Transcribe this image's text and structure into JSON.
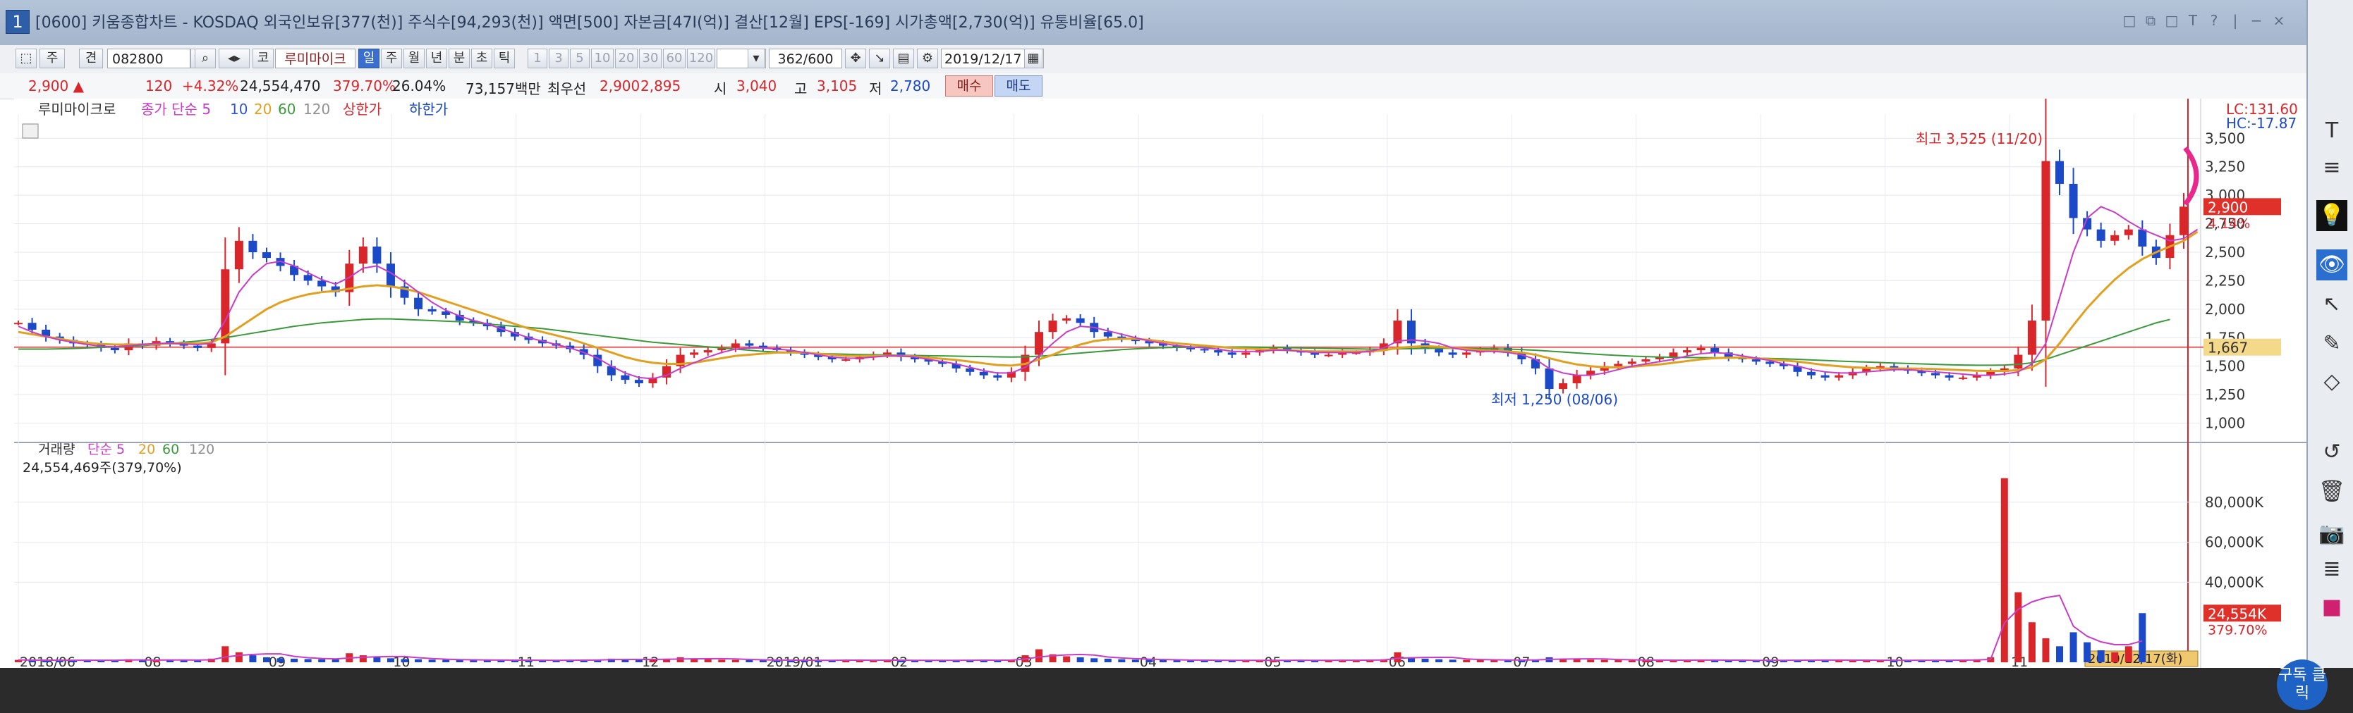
{
  "window": {
    "title": "[0600] 키움종합차트 - KOSDAQ 외국인보유[377(천)] 주식수[94,293(천)] 액면[500] 자본금[47I(억)] 결산[12월] EPS[-169] 시가총액[2,730(억)] 유통비율[65.0]",
    "app_icon": "1",
    "controls": [
      "□",
      "⧉",
      "□",
      "T",
      "?",
      "|",
      "−",
      "×"
    ]
  },
  "toolbar": {
    "main_menu": "주",
    "period_type": "견",
    "stock_code": "082800",
    "stock_prefix": "코",
    "stock_name": "루미마이크",
    "periods": [
      "일",
      "주",
      "월",
      "년",
      "분",
      "초",
      "틱"
    ],
    "minutes": [
      "1",
      "3",
      "5",
      "10",
      "20",
      "30",
      "60",
      "120"
    ],
    "count": "362/600",
    "date": "2019/12/17"
  },
  "quote": {
    "price": "2,900 ▲",
    "change": "120",
    "change_pct": "+4.32%",
    "volume": "24,554,470",
    "volume_ratio": "379.70%",
    "turnover": "26.04%",
    "amount": "73,157백만",
    "best_ask_label": "최우선",
    "ask": "2,900",
    "bid": "2,895",
    "open_label": "시",
    "open": "3,040",
    "high_label": "고",
    "high": "3,105",
    "low_label": "저",
    "low": "2,780",
    "buy_label": "매수",
    "sell_label": "매도"
  },
  "colors": {
    "up": "#d8262b",
    "down": "#1b49c8",
    "ma5": "#c83cc8",
    "ma10": "#3355cc",
    "ma20": "#e0a020",
    "ma60": "#3a9a3a",
    "ma120": "#909090"
  },
  "chart_data": [
    {
      "type": "candlestick",
      "title": "",
      "legend": {
        "name": "루미마이크로",
        "items": [
          "종가 단순 5",
          "10",
          "20",
          "60",
          "120",
          "상한가",
          "하한가"
        ]
      },
      "x_ticks": [
        "2018/06",
        "08",
        "09",
        "10",
        "11",
        "12",
        "2019/01",
        "02",
        "03",
        "04",
        "05",
        "06",
        "07",
        "08",
        "09",
        "10",
        "11",
        "12"
      ],
      "y_ticks": [
        "3,500",
        "3,250",
        "3,000",
        "2,750",
        "2,500",
        "2,250",
        "2,000",
        "1,750",
        "1,500",
        "1,250",
        "1,000"
      ],
      "ylim": [
        880,
        3650
      ],
      "annotations": {
        "high": "최고 3,525 (11/20)",
        "low": "최저 1,250 (08/06)",
        "lc": "LC:131.60",
        "hc": "HC:-17.87",
        "price_tag": "2,900",
        "pct_tag": "4.14%",
        "ref_tag": "1,667"
      },
      "reference_line": 1667,
      "series_close": [
        1880,
        1820,
        1760,
        1730,
        1700,
        1690,
        1660,
        1640,
        1700,
        1680,
        1720,
        1700,
        1680,
        1660,
        1700,
        2350,
        2600,
        2500,
        2450,
        2380,
        2300,
        2250,
        2200,
        2150,
        2400,
        2550,
        2400,
        2200,
        2100,
        2000,
        1980,
        1950,
        1900,
        1880,
        1850,
        1800,
        1760,
        1730,
        1700,
        1680,
        1650,
        1600,
        1500,
        1420,
        1380,
        1350,
        1400,
        1500,
        1600,
        1620,
        1640,
        1660,
        1700,
        1680,
        1660,
        1640,
        1620,
        1600,
        1580,
        1560,
        1560,
        1580,
        1600,
        1620,
        1580,
        1560,
        1540,
        1520,
        1480,
        1450,
        1420,
        1400,
        1450,
        1600,
        1800,
        1900,
        1920,
        1880,
        1800,
        1760,
        1740,
        1720,
        1700,
        1680,
        1660,
        1650,
        1640,
        1620,
        1600,
        1620,
        1640,
        1660,
        1640,
        1620,
        1600,
        1600,
        1620,
        1620,
        1640,
        1700,
        1900,
        1700,
        1650,
        1620,
        1600,
        1620,
        1640,
        1660,
        1620,
        1560,
        1480,
        1300,
        1350,
        1420,
        1460,
        1500,
        1520,
        1540,
        1560,
        1580,
        1620,
        1640,
        1660,
        1620,
        1580,
        1560,
        1540,
        1520,
        1500,
        1450,
        1420,
        1400,
        1420,
        1450,
        1480,
        1500,
        1480,
        1460,
        1440,
        1420,
        1400,
        1400,
        1420,
        1450,
        1480,
        1600,
        1900,
        3300,
        3100,
        2800,
        2700,
        2600,
        2650,
        2700,
        2550,
        2450,
        2650,
        2900
      ],
      "ma5": [
        1850,
        1800,
        1760,
        1730,
        1710,
        1690,
        1675,
        1670,
        1680,
        1690,
        1700,
        1700,
        1695,
        1690,
        1700,
        1900,
        2150,
        2300,
        2400,
        2420,
        2380,
        2320,
        2260,
        2220,
        2280,
        2360,
        2380,
        2320,
        2240,
        2150,
        2060,
        1990,
        1940,
        1900,
        1870,
        1830,
        1790,
        1750,
        1720,
        1690,
        1660,
        1620,
        1570,
        1500,
        1440,
        1400,
        1390,
        1420,
        1480,
        1530,
        1580,
        1620,
        1650,
        1660,
        1660,
        1650,
        1640,
        1620,
        1600,
        1580,
        1570,
        1570,
        1580,
        1590,
        1590,
        1580,
        1560,
        1540,
        1520,
        1490,
        1460,
        1440,
        1440,
        1490,
        1590,
        1700,
        1800,
        1850,
        1840,
        1810,
        1780,
        1750,
        1720,
        1700,
        1680,
        1670,
        1660,
        1650,
        1630,
        1630,
        1630,
        1640,
        1640,
        1630,
        1620,
        1620,
        1620,
        1620,
        1630,
        1660,
        1720,
        1730,
        1720,
        1700,
        1660,
        1640,
        1630,
        1630,
        1620,
        1600,
        1560,
        1480,
        1440,
        1420,
        1420,
        1440,
        1470,
        1500,
        1520,
        1540,
        1560,
        1590,
        1610,
        1620,
        1610,
        1590,
        1570,
        1550,
        1520,
        1500,
        1470,
        1450,
        1440,
        1440,
        1450,
        1460,
        1470,
        1470,
        1460,
        1450,
        1440,
        1430,
        1420,
        1420,
        1430,
        1450,
        1520,
        1700,
        2100,
        2500,
        2800,
        2900,
        2850,
        2770,
        2700,
        2650,
        2600,
        2620,
        2700
      ],
      "ma20": [
        1800,
        1780,
        1760,
        1740,
        1720,
        1705,
        1695,
        1690,
        1690,
        1690,
        1695,
        1700,
        1700,
        1700,
        1710,
        1760,
        1840,
        1920,
        2000,
        2060,
        2100,
        2130,
        2150,
        2160,
        2180,
        2200,
        2210,
        2200,
        2180,
        2150,
        2110,
        2070,
        2030,
        1990,
        1950,
        1910,
        1870,
        1830,
        1800,
        1770,
        1740,
        1700,
        1660,
        1620,
        1580,
        1550,
        1530,
        1520,
        1520,
        1530,
        1550,
        1570,
        1590,
        1600,
        1610,
        1620,
        1620,
        1620,
        1610,
        1600,
        1590,
        1590,
        1590,
        1590,
        1590,
        1585,
        1575,
        1565,
        1555,
        1540,
        1525,
        1510,
        1505,
        1520,
        1560,
        1600,
        1650,
        1690,
        1720,
        1735,
        1740,
        1740,
        1730,
        1715,
        1700,
        1690,
        1680,
        1670,
        1660,
        1655,
        1650,
        1645,
        1640,
        1635,
        1630,
        1630,
        1630,
        1630,
        1630,
        1640,
        1660,
        1670,
        1675,
        1670,
        1660,
        1650,
        1640,
        1635,
        1630,
        1620,
        1600,
        1570,
        1540,
        1515,
        1500,
        1490,
        1490,
        1495,
        1505,
        1515,
        1530,
        1545,
        1560,
        1570,
        1575,
        1575,
        1570,
        1560,
        1550,
        1540,
        1525,
        1510,
        1500,
        1490,
        1485,
        1480,
        1480,
        1480,
        1478,
        1475,
        1470,
        1465,
        1460,
        1458,
        1458,
        1465,
        1490,
        1560,
        1700,
        1860,
        2010,
        2140,
        2260,
        2360,
        2440,
        2500,
        2550,
        2600,
        2680
      ],
      "ma60": [
        1650,
        1650,
        1650,
        1652,
        1655,
        1660,
        1665,
        1670,
        1675,
        1680,
        1690,
        1700,
        1710,
        1720,
        1735,
        1750,
        1770,
        1790,
        1810,
        1830,
        1850,
        1865,
        1880,
        1890,
        1900,
        1910,
        1915,
        1915,
        1910,
        1905,
        1900,
        1895,
        1890,
        1880,
        1870,
        1860,
        1850,
        1840,
        1830,
        1815,
        1800,
        1785,
        1770,
        1755,
        1740,
        1725,
        1710,
        1700,
        1690,
        1680,
        1670,
        1660,
        1650,
        1640,
        1630,
        1625,
        1620,
        1615,
        1610,
        1608,
        1605,
        1602,
        1600,
        1598,
        1596,
        1594,
        1592,
        1590,
        1588,
        1586,
        1584,
        1582,
        1580,
        1582,
        1588,
        1595,
        1605,
        1615,
        1625,
        1635,
        1645,
        1652,
        1658,
        1662,
        1665,
        1667,
        1668,
        1668,
        1668,
        1668,
        1666,
        1664,
        1662,
        1660,
        1658,
        1656,
        1654,
        1652,
        1650,
        1650,
        1652,
        1654,
        1656,
        1657,
        1657,
        1656,
        1654,
        1652,
        1650,
        1646,
        1640,
        1632,
        1624,
        1616,
        1608,
        1600,
        1594,
        1588,
        1584,
        1580,
        1578,
        1576,
        1575,
        1574,
        1573,
        1572,
        1570,
        1568,
        1565,
        1560,
        1555,
        1550,
        1545,
        1540,
        1536,
        1532,
        1528,
        1524,
        1520,
        1516,
        1512,
        1510,
        1508,
        1508,
        1510,
        1516,
        1530,
        1560,
        1600,
        1640,
        1680,
        1720,
        1760,
        1800,
        1840,
        1880,
        1910
      ]
    },
    {
      "type": "bar",
      "title": "",
      "legend": {
        "name": "거래량",
        "items": [
          "단순 5",
          "20",
          "60",
          "120"
        ],
        "value": "24,554,469주(379,70%)"
      },
      "y_ticks": [
        "80,000K",
        "60,000K",
        "40,000K"
      ],
      "ylim": [
        0,
        100000
      ],
      "last_volume_tag": "24,554K",
      "last_pct_tag": "379.70%",
      "cursor_date": "2019/12/17(화)",
      "values": [
        1200,
        900,
        1100,
        800,
        1000,
        1300,
        900,
        1100,
        1500,
        1200,
        900,
        1000,
        1100,
        1300,
        1800,
        8000,
        5000,
        3500,
        2500,
        2000,
        1800,
        1600,
        1500,
        1400,
        4500,
        3500,
        2800,
        2000,
        1600,
        1500,
        1300,
        1200,
        1100,
        1000,
        1200,
        900,
        1100,
        1000,
        900,
        1000,
        1100,
        1200,
        1400,
        1800,
        1500,
        1200,
        1100,
        1800,
        2500,
        1900,
        1500,
        1300,
        1200,
        1100,
        1000,
        900,
        1000,
        1100,
        900,
        1000,
        1200,
        1000,
        900,
        1100,
        1000,
        900,
        1000,
        900,
        1100,
        1200,
        1000,
        900,
        1400,
        3500,
        6500,
        4000,
        3000,
        2500,
        2000,
        1800,
        1500,
        1300,
        1200,
        1100,
        1000,
        1000,
        900,
        1000,
        900,
        1100,
        1000,
        900,
        1000,
        1000,
        900,
        1000,
        1100,
        1000,
        1200,
        1500,
        5000,
        2500,
        1800,
        1500,
        1300,
        1200,
        1100,
        1100,
        1000,
        1200,
        1400,
        2500,
        1800,
        1500,
        1300,
        1200,
        1100,
        1000,
        1000,
        1100,
        1000,
        1200,
        1100,
        1000,
        900,
        1000,
        900,
        1000,
        1100,
        1000,
        1200,
        1100,
        1000,
        900,
        1000,
        1100,
        1000,
        900,
        1000,
        1000,
        1100,
        1200,
        1500,
        2500,
        92000,
        35000,
        20000,
        12000,
        8000,
        15000,
        10000,
        6000,
        5000,
        8000,
        24554
      ]
    }
  ],
  "right_panel": {
    "tools": [
      "T",
      "≡",
      "💡",
      "👁",
      "↖",
      "✎",
      "◇",
      "↺",
      "🗑",
      "📷",
      "≣",
      "■"
    ]
  },
  "overlay": {
    "watermark": "구독 클릭"
  }
}
